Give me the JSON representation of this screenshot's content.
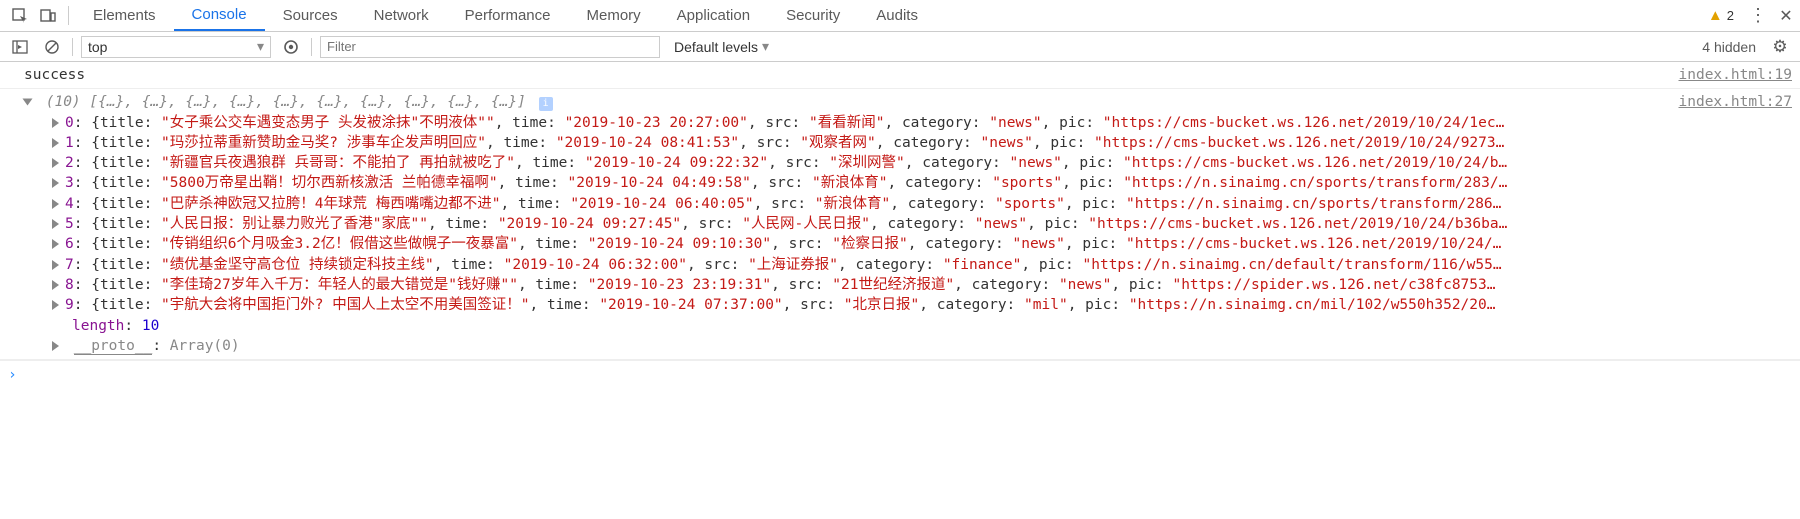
{
  "tabs": [
    "Elements",
    "Console",
    "Sources",
    "Network",
    "Performance",
    "Memory",
    "Application",
    "Security",
    "Audits"
  ],
  "activeTab": "Console",
  "warnings": "2",
  "contextLabel": "top",
  "filterPlaceholder": "Filter",
  "levelsLabel": "Default levels",
  "hiddenLabel": "4 hidden",
  "successText": "success",
  "source1": "index.html:19",
  "source2": "index.html:27",
  "arrayHeader": "(10) [{…}, {…}, {…}, {…}, {…}, {…}, {…}, {…}, {…}, {…}]",
  "lengthKey": "length",
  "lengthVal": "10",
  "protoLabel": "__proto__",
  "protoVal": "Array(0)",
  "props": [
    "title",
    "time",
    "src",
    "category",
    "pic"
  ],
  "rows": [
    {
      "idx": "0",
      "title": "\"女子乘公交车遇变态男子 头发被涂抹\"不明液体\"\"",
      "time": "\"2019-10-23 20:27:00\"",
      "src": "\"看看新闻\"",
      "category": "\"news\"",
      "pic": "\"https://cms-bucket.ws.126.net/2019/10/24/1ec…"
    },
    {
      "idx": "1",
      "title": "\"玛莎拉蒂重新赞助金马奖? 涉事车企发声明回应\"",
      "time": "\"2019-10-24 08:41:53\"",
      "src": "\"观察者网\"",
      "category": "\"news\"",
      "pic": "\"https://cms-bucket.ws.126.net/2019/10/24/9273…"
    },
    {
      "idx": "2",
      "title": "\"新疆官兵夜遇狼群 兵哥哥：不能拍了  再拍就被吃了\"",
      "time": "\"2019-10-24 09:22:32\"",
      "src": "\"深圳网警\"",
      "category": "\"news\"",
      "pic": "\"https://cms-bucket.ws.126.net/2019/10/24/b…"
    },
    {
      "idx": "3",
      "title": "\"5800万帝星出鞘！切尔西新核激活 兰帕德幸福啊\"",
      "time": "\"2019-10-24 04:49:58\"",
      "src": "\"新浪体育\"",
      "category": "\"sports\"",
      "pic": "\"https://n.sinaimg.cn/sports/transform/283/…"
    },
    {
      "idx": "4",
      "title": "\"巴萨杀神欧冠又拉胯！4年球荒 梅西嘴嘴边都不进\"",
      "time": "\"2019-10-24 06:40:05\"",
      "src": "\"新浪体育\"",
      "category": "\"sports\"",
      "pic": "\"https://n.sinaimg.cn/sports/transform/286…"
    },
    {
      "idx": "5",
      "title": "\"人民日报：别让暴力败光了香港\"家底\"\"",
      "time": "\"2019-10-24 09:27:45\"",
      "src": "\"人民网-人民日报\"",
      "category": "\"news\"",
      "pic": "\"https://cms-bucket.ws.126.net/2019/10/24/b36ba…"
    },
    {
      "idx": "6",
      "title": "\"传销组织6个月吸金3.2亿！假借这些做幌子一夜暴富\"",
      "time": "\"2019-10-24 09:10:30\"",
      "src": "\"检察日报\"",
      "category": "\"news\"",
      "pic": "\"https://cms-bucket.ws.126.net/2019/10/24/…"
    },
    {
      "idx": "7",
      "title": "\"绩优基金坚守高仓位 持续锁定科技主线\"",
      "time": "\"2019-10-24 06:32:00\"",
      "src": "\"上海证券报\"",
      "category": "\"finance\"",
      "pic": "\"https://n.sinaimg.cn/default/transform/116/w55…"
    },
    {
      "idx": "8",
      "title": "\"李佳琦27岁年入千万：年轻人的最大错觉是\"钱好赚\"\"",
      "time": "\"2019-10-23 23:19:31\"",
      "src": "\"21世纪经济报道\"",
      "category": "\"news\"",
      "pic": "\"https://spider.ws.126.net/c38fc8753…"
    },
    {
      "idx": "9",
      "title": "\"宇航大会将中国拒门外? 中国人上太空不用美国签证！\"",
      "time": "\"2019-10-24 07:37:00\"",
      "src": "\"北京日报\"",
      "category": "\"mil\"",
      "pic": "\"https://n.sinaimg.cn/mil/102/w550h352/20…"
    }
  ]
}
